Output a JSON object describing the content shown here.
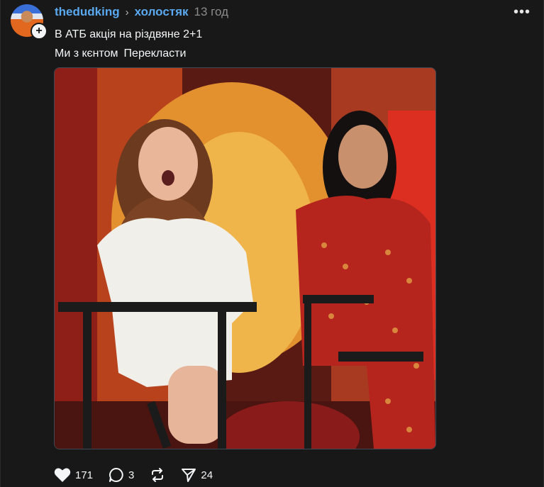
{
  "post": {
    "username": "thedudking",
    "community": "холостяк",
    "time": "13 год",
    "line1": "В АТБ акція на різдвяне 2+1",
    "line2": "Ми з кєнтом",
    "translate_label": "Перекласти",
    "more_label": "•••"
  },
  "actions": {
    "likes": "171",
    "comments": "3",
    "shares": "24"
  },
  "icons": {
    "avatar": "avatar-icon",
    "follow": "plus-icon",
    "more": "more-icon",
    "like": "heart-icon",
    "comment": "comment-icon",
    "repost": "repost-icon",
    "share": "send-icon"
  },
  "colors": {
    "background": "#181818",
    "link": "#5aa9f0",
    "muted": "#8b8b8b"
  }
}
